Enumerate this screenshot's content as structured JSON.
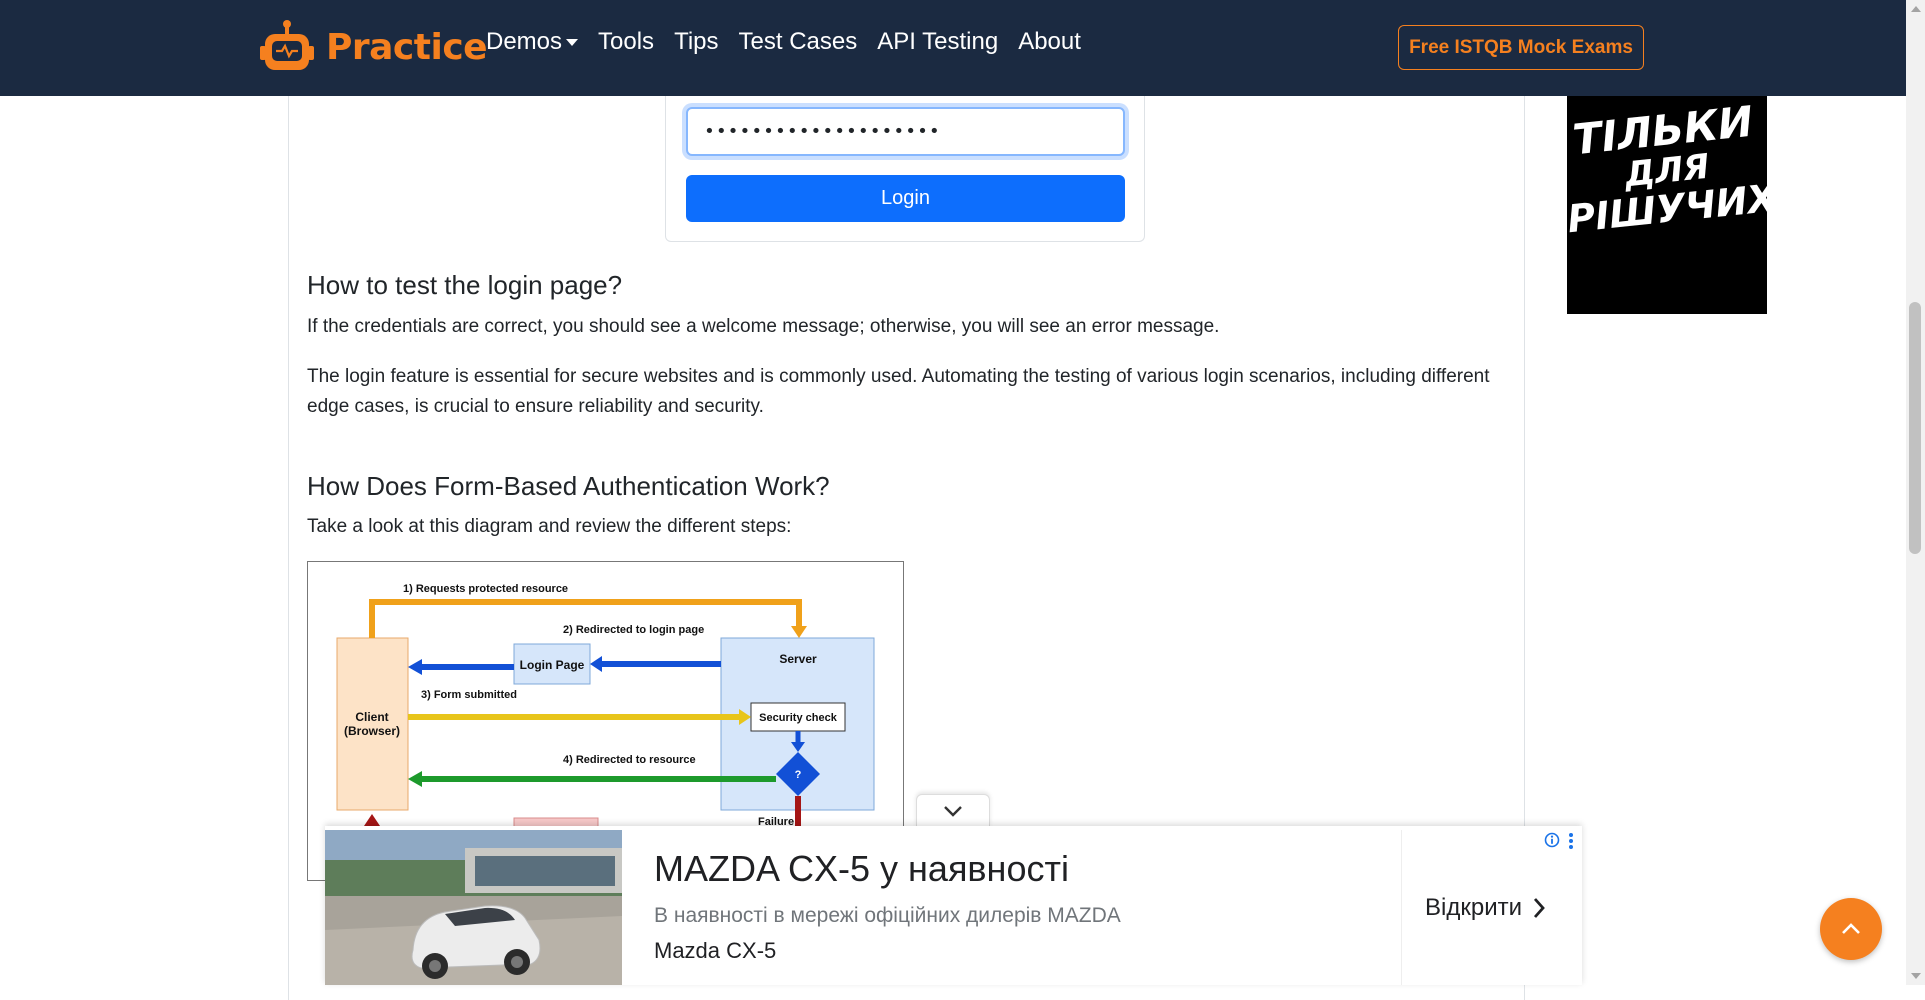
{
  "navbar": {
    "brand": "Practice",
    "links": [
      "Demos",
      "Tools",
      "Tips",
      "Test Cases",
      "API Testing",
      "About"
    ],
    "cta": "Free ISTQB Mock Exams"
  },
  "login_form": {
    "password_value": "••••••••••••••••••••",
    "login_button": "Login"
  },
  "section1": {
    "heading": "How to test the login page?",
    "para1": "If the credentials are correct, you should see a welcome message; otherwise, you will see an error message.",
    "para2": "The login feature is essential for secure websites and is commonly used. Automating the testing of various login scenarios, including different edge cases, is crucial to ensure reliability and security."
  },
  "section2": {
    "heading": "How Does Form-Based Authentication Work?",
    "intro": "Take a look at this diagram and review the different steps:"
  },
  "diagram": {
    "step1": "1) Requests protected resource",
    "step2": "2) Redirected to login page",
    "step3": "3) Form submitted",
    "step4": "4) Redirected to resource",
    "client_line1": "Client",
    "client_line2": "(Browser)",
    "login_page": "Login Page",
    "server": "Server",
    "security_check": "Security check",
    "decision": "?",
    "failure": "Failure"
  },
  "side_ad": {
    "line1": "ТІЛЬКИ",
    "line2": "ДЛЯ",
    "line3": "РІШУЧИХ"
  },
  "bottom_ad": {
    "title": "MAZDA CX-5 у наявності",
    "description": "В наявності в мережі офіційних дилерів MAZDA",
    "brand": "Mazda CX-5",
    "open": "Відкрити"
  },
  "colors": {
    "navbar_bg": "#1b2a41",
    "brand_orange": "#f5801f",
    "primary_blue": "#0d6efd"
  },
  "icons": [
    "robot-logo-icon",
    "caret-down-icon",
    "chevron-down-icon",
    "info-icon",
    "kebab-menu-icon",
    "chevron-right-icon",
    "chevron-up-icon"
  ]
}
